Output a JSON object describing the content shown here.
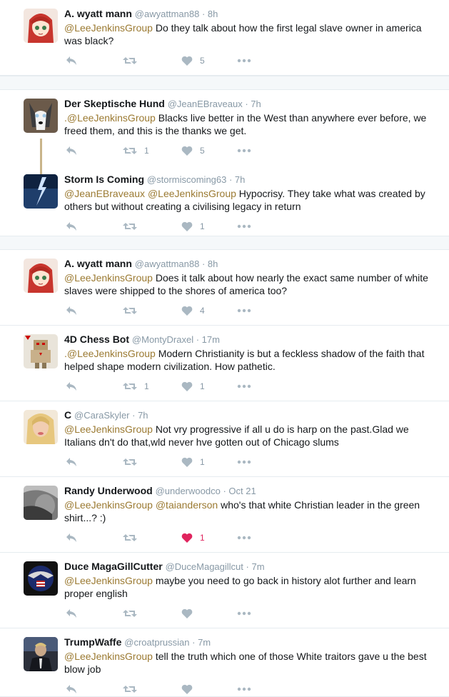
{
  "tweets": [
    {
      "id": "t1",
      "name": "A. wyatt mann",
      "handle": "@awyattman88",
      "time": "8h",
      "mentions": "@LeeJenkinsGroup",
      "text": "Do they talk about how the first legal slave owner in america was black?",
      "retweets": "",
      "likes": "5",
      "liked": false,
      "avatar": "anime-girl"
    },
    {
      "id": "t2",
      "name": "Der Skeptische Hund",
      "handle": "@JeanEBraveaux",
      "time": "7h",
      "mentions": ".@LeeJenkinsGroup",
      "text": "Blacks live better in the West than anywhere ever before, we freed them, and this is the thanks we get.",
      "retweets": "1",
      "likes": "5",
      "liked": false,
      "avatar": "husky"
    },
    {
      "id": "t3",
      "name": "Storm Is Coming",
      "handle": "@stormiscoming63",
      "time": "7h",
      "mentions": "@JeanEBraveaux @LeeJenkinsGroup",
      "text": "Hypocrisy. They take what was created by others but without creating a civilising legacy in return",
      "retweets": "",
      "likes": "1",
      "liked": false,
      "avatar": "storm"
    },
    {
      "id": "t4",
      "name": "A. wyatt mann",
      "handle": "@awyattman88",
      "time": "8h",
      "mentions": "@LeeJenkinsGroup",
      "text": "Does it talk about how nearly the exact same number of white slaves were shipped to the shores of america too?",
      "retweets": "",
      "likes": "4",
      "liked": false,
      "avatar": "anime-girl"
    },
    {
      "id": "t5",
      "name": "4D Chess Bot",
      "handle": "@MontyDraxel",
      "time": "17m",
      "mentions": ".@LeeJenkinsGroup",
      "text": "Modern Christianity is but a feckless shadow of the faith that helped shape modern civilization. How pathetic.",
      "retweets": "1",
      "likes": "1",
      "liked": false,
      "avatar": "robot"
    },
    {
      "id": "t6",
      "name": "C",
      "handle": "@CaraSkyler",
      "time": "7h",
      "mentions": "@LeeJenkinsGroup",
      "text": "Not vry progressive if all u do is harp on the past.Glad we Italians dn't do that,wld never hve gotten out of Chicago slums",
      "retweets": "",
      "likes": "1",
      "liked": false,
      "avatar": "blonde"
    },
    {
      "id": "t7",
      "name": "Randy Underwood",
      "handle": "@underwoodco",
      "time": "Oct 21",
      "mentions": "@LeeJenkinsGroup @taianderson",
      "text": "who's that white Christian leader in the green shirt...? :)",
      "retweets": "",
      "likes": "1",
      "liked": true,
      "avatar": "bw-face"
    },
    {
      "id": "t8",
      "name": "Duce MagaGillCutter",
      "handle": "@DuceMagagillcut",
      "time": "7m",
      "mentions": "@LeeJenkinsGroup",
      "text": "maybe you need to go back in history alot further and learn proper english",
      "retweets": "",
      "likes": "",
      "liked": false,
      "avatar": "eagle-emblem"
    },
    {
      "id": "t9",
      "name": "TrumpWaffe",
      "handle": "@croatprussian",
      "time": "7m",
      "mentions": "@LeeJenkinsGroup",
      "text": "tell the truth which one of those White traitors gave u the best blow job",
      "retweets": "",
      "likes": "",
      "liked": false,
      "avatar": "suit-man"
    }
  ],
  "colors": {
    "mention": "#9b7a32",
    "action": "#aab8c2",
    "liked": "#e0245e",
    "thread": "#c9b48a"
  }
}
